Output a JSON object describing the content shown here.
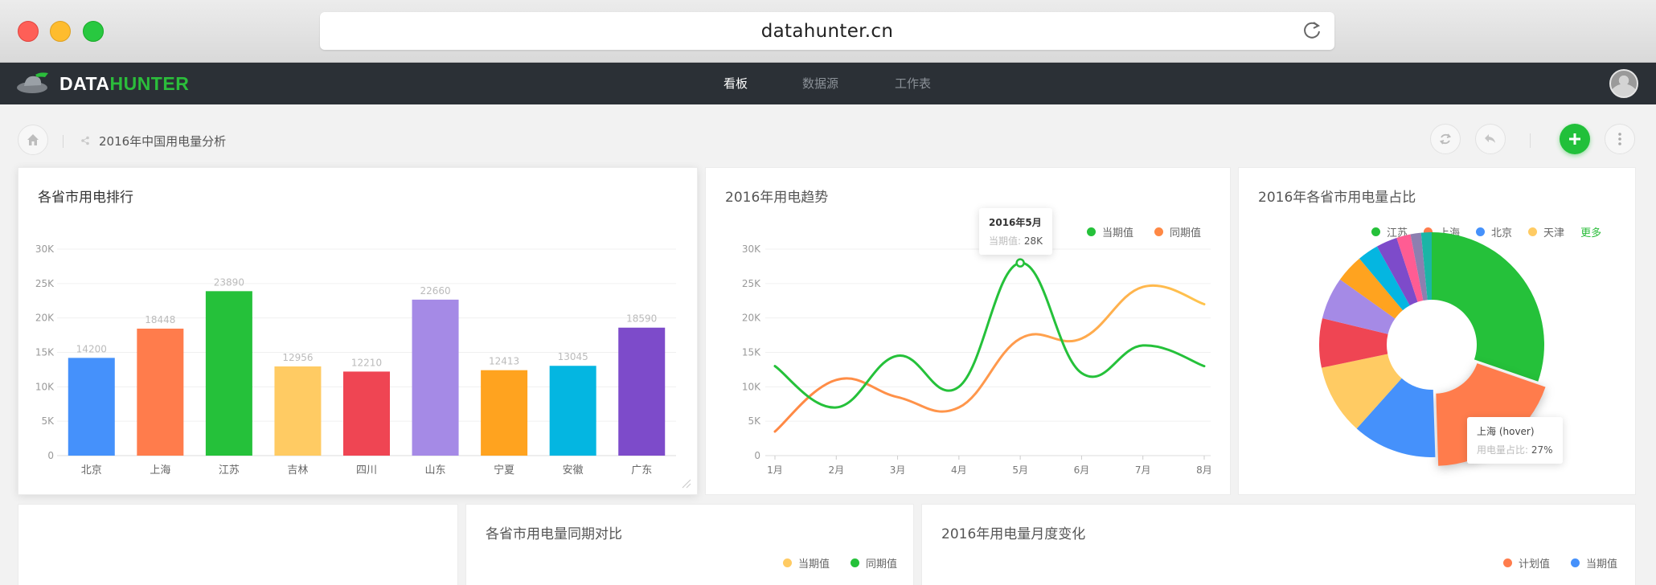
{
  "browser": {
    "url": "datahunter.cn",
    "traffic_lights": {
      "close": "#fe5f57",
      "minimize": "#febc2e",
      "zoom": "#28c840"
    }
  },
  "app": {
    "logo_data": "DATA",
    "logo_hunter": "HUNTER",
    "brand_color": "#2bbd3b",
    "nav": [
      {
        "label": "看板",
        "active": true
      },
      {
        "label": "数据源",
        "active": false
      },
      {
        "label": "工作表",
        "active": false
      }
    ]
  },
  "toolbar": {
    "breadcrumb_title": "2016年中国用电量分析"
  },
  "cards": {
    "ranking": {
      "title": "各省市用电排行",
      "y_ticks": [
        "30K",
        "25K",
        "20K",
        "15K",
        "10K",
        "5K",
        "0"
      ]
    },
    "trend": {
      "title": "2016年用电趋势",
      "legend": [
        "当期值",
        "同期值"
      ],
      "y_ticks": [
        "30K",
        "25K",
        "20K",
        "15K",
        "10K",
        "5K",
        "0"
      ],
      "tooltip": {
        "title": "2016年5月",
        "label": "当期值:",
        "value": "28K"
      }
    },
    "share": {
      "title": "2016年各省市用电量占比",
      "legend": [
        "江苏",
        "上海",
        "北京",
        "天津"
      ],
      "more": "更多",
      "tooltip": {
        "title": "上海 (hover)",
        "label": "用电量占比:",
        "value": "27%"
      }
    },
    "yoy": {
      "title": "各省市用电量同期对比",
      "legend": [
        "当期值",
        "同期值"
      ]
    },
    "monthly": {
      "title": "2016年用电量月度变化",
      "legend": [
        "计划值",
        "当期值"
      ]
    }
  },
  "chart_data": [
    {
      "type": "bar",
      "title": "各省市用电排行",
      "categories": [
        "北京",
        "上海",
        "江苏",
        "吉林",
        "四川",
        "山东",
        "宁夏",
        "安徽",
        "广东"
      ],
      "values": [
        14200,
        18448,
        23890,
        12956,
        12210,
        22660,
        12413,
        13045,
        18590
      ],
      "colors": [
        "#4591fb",
        "#ff7c4c",
        "#25c13a",
        "#ffcb63",
        "#ef4553",
        "#a58ae6",
        "#ffa31f",
        "#04b6e1",
        "#7d4bca"
      ],
      "ylim": [
        0,
        30000
      ],
      "grid": true
    },
    {
      "type": "line",
      "title": "2016年用电趋势",
      "categories": [
        "1月",
        "2月",
        "3月",
        "4月",
        "5月",
        "6月",
        "7月",
        "8月"
      ],
      "series": [
        {
          "name": "当期值",
          "color": "#25c13a",
          "values": [
            13000,
            7000,
            14500,
            10000,
            28000,
            12000,
            16000,
            13000
          ]
        },
        {
          "name": "同期值",
          "color": "#ff8844",
          "values": [
            3500,
            11000,
            8500,
            7000,
            17000,
            17000,
            24500,
            22000
          ]
        }
      ],
      "second_series_color": "#ffc44d",
      "ylim": [
        0,
        30000
      ],
      "grid": true,
      "legend": "top-right"
    },
    {
      "type": "pie",
      "title": "2016年各省市用电量占比",
      "slices": [
        {
          "label": "江苏",
          "value": 30,
          "color": "#25c13a"
        },
        {
          "label": "上海",
          "value": 19,
          "color": "#ff7c4c"
        },
        {
          "label": "北京",
          "value": 12,
          "color": "#4591fb"
        },
        {
          "label": "",
          "value": 10,
          "color": "#ffcb63"
        },
        {
          "label": "",
          "value": 7,
          "color": "#ef4553"
        },
        {
          "label": "",
          "value": 6,
          "color": "#a58ae6"
        },
        {
          "label": "",
          "value": 4,
          "color": "#ffa31f"
        },
        {
          "label": "",
          "value": 3,
          "color": "#04b6e1"
        },
        {
          "label": "",
          "value": 3,
          "color": "#7d4bca"
        },
        {
          "label": "",
          "value": 2,
          "color": "#ff5c93"
        },
        {
          "label": "",
          "value": 1.5,
          "color": "#8d7fb0"
        },
        {
          "label": "",
          "value": 1.5,
          "color": "#1bb5a6"
        }
      ],
      "donut": true,
      "legend": "top-right"
    }
  ]
}
